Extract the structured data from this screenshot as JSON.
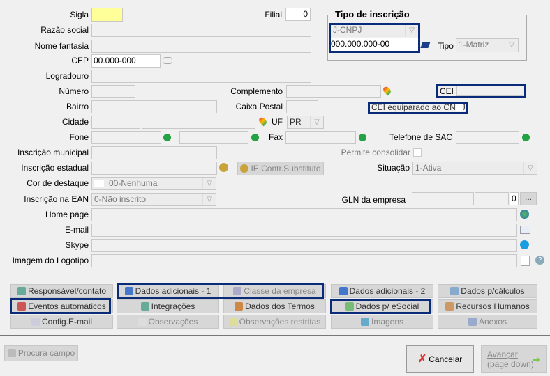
{
  "fields": {
    "sigla": "Sigla",
    "filial": "Filial",
    "filial_value": "0",
    "razao": "Razão social",
    "fantasia": "Nome fantasia",
    "cep": "CEP",
    "cep_value": "00.000-000",
    "logradouro": "Logradouro",
    "numero": "Número",
    "complemento": "Complemento",
    "bairro": "Bairro",
    "caixa": "Caixa Postal",
    "cidade": "Cidade",
    "uf": "UF",
    "uf_value": "PR",
    "fone": "Fone",
    "fax": "Fax",
    "sac": "Telefone de SAC",
    "insc_mun": "Inscrição municipal",
    "consolidar": "Permite consolidar",
    "insc_est": "Inscrição estadual",
    "ie_button": "IE Contr.Substituto",
    "situacao": "Situação",
    "situacao_value": "1-Ativa",
    "cor": "Cor de destaque",
    "cor_value": "00-Nenhuma",
    "ean": "Inscrição na EAN",
    "ean_value": "0-Não inscrito",
    "gln": "GLN da empresa",
    "gln_value": "0",
    "gln_button": "...",
    "home": "Home page",
    "email": "E-mail",
    "skype": "Skype",
    "logo": "Imagem do Logotipo"
  },
  "inscricao": {
    "title": "Tipo de inscrição",
    "tipo_value": "J-CNPJ",
    "numero": "000.000.000-00",
    "tipo_label": "Tipo",
    "tipo2_value": "1-Matriz",
    "cei": "CEI",
    "cei_equiparado": "CEI equiparado ao CNPJ"
  },
  "buttons": [
    [
      "Responsável/contato",
      "Dados adicionais - 1",
      "Classe da empresa",
      "Dados adicionais - 2",
      "Dados p/cálculos"
    ],
    [
      "Eventos automáticos",
      "Integrações",
      "Dados dos Termos",
      "Dados p/ eSocial",
      "Recursos Humanos"
    ],
    [
      "Config.E-mail",
      "Observações",
      "Observações restritas",
      "Imagens",
      "Anexos"
    ]
  ],
  "footer": {
    "procura": "Procura campo",
    "cancelar": "Cancelar",
    "avancar": "Avançar",
    "avancar2": "(page down)"
  },
  "colors": {
    "highlight": "#0a2a7a",
    "sigla_bg": "#ffff99"
  }
}
